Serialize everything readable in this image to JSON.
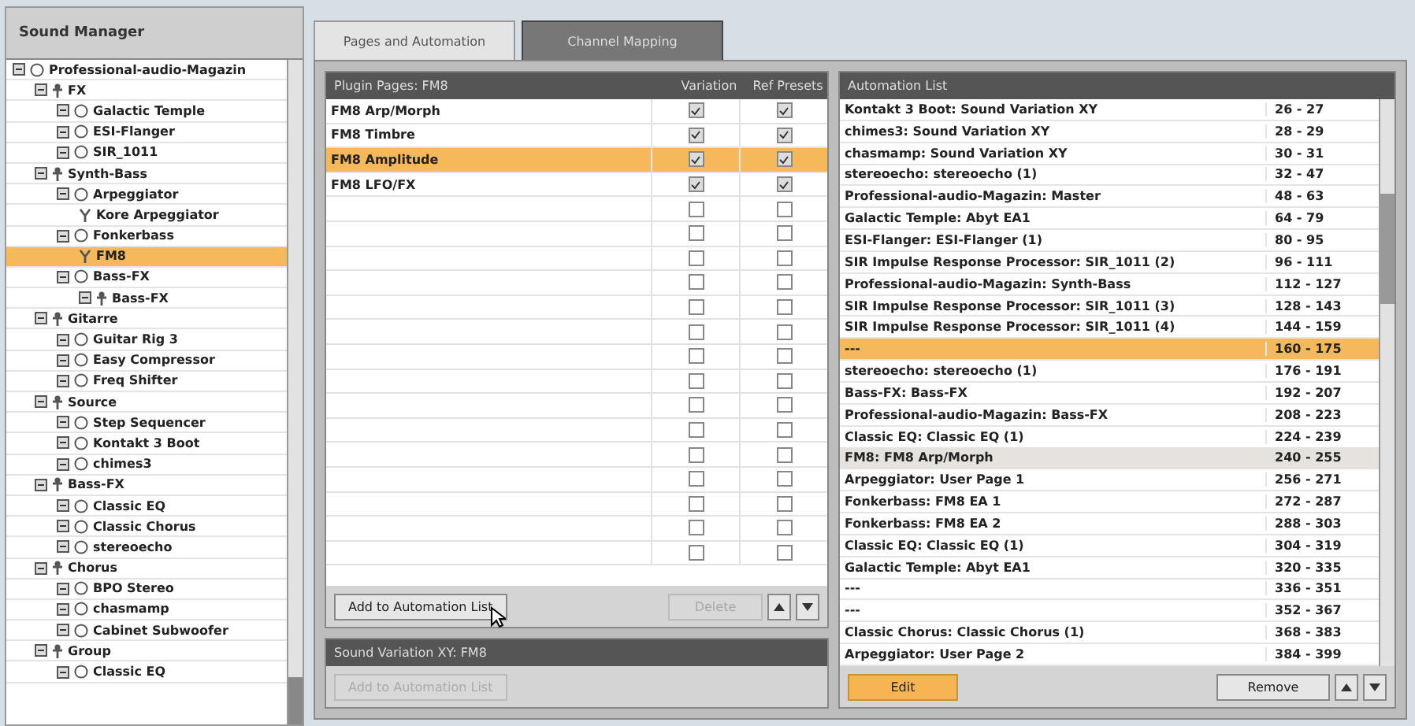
{
  "window": {
    "title": "Sound Manager"
  },
  "tree": [
    {
      "label": "Professional-audio-Magazin",
      "kind": "plugin",
      "selected": false,
      "children": [
        {
          "label": "FX",
          "kind": "group",
          "selected": false,
          "children": [
            {
              "label": "Galactic Temple",
              "kind": "plugin",
              "selected": false
            },
            {
              "label": "ESI-Flanger",
              "kind": "plugin",
              "selected": false
            },
            {
              "label": "SIR_1011",
              "kind": "plugin",
              "selected": false
            }
          ]
        },
        {
          "label": "Synth-Bass",
          "kind": "group",
          "selected": false,
          "children": [
            {
              "label": "Arpeggiator",
              "kind": "plugin",
              "selected": false,
              "children": [
                {
                  "label": "Kore Arpeggiator",
                  "kind": "page",
                  "selected": false
                }
              ]
            },
            {
              "label": "Fonkerbass",
              "kind": "plugin",
              "selected": false,
              "children": [
                {
                  "label": "FM8",
                  "kind": "page",
                  "selected": true
                }
              ]
            },
            {
              "label": "Bass-FX",
              "kind": "plugin",
              "selected": false,
              "children": [
                {
                  "label": "Bass-FX",
                  "kind": "group",
                  "selected": false
                }
              ]
            }
          ]
        },
        {
          "label": "Gitarre",
          "kind": "group",
          "selected": false,
          "children": [
            {
              "label": "Guitar Rig 3",
              "kind": "plugin",
              "selected": false
            },
            {
              "label": "Easy Compressor",
              "kind": "plugin",
              "selected": false
            },
            {
              "label": "Freq Shifter",
              "kind": "plugin",
              "selected": false
            }
          ]
        },
        {
          "label": "Source",
          "kind": "group",
          "selected": false,
          "children": [
            {
              "label": "Step Sequencer",
              "kind": "plugin",
              "selected": false
            },
            {
              "label": "Kontakt 3 Boot",
              "kind": "plugin",
              "selected": false
            },
            {
              "label": "chimes3",
              "kind": "plugin",
              "selected": false
            }
          ]
        },
        {
          "label": "Bass-FX",
          "kind": "group",
          "selected": false,
          "children": [
            {
              "label": "Classic EQ",
              "kind": "plugin",
              "selected": false
            },
            {
              "label": "Classic Chorus",
              "kind": "plugin",
              "selected": false
            },
            {
              "label": "stereoecho",
              "kind": "plugin",
              "selected": false
            }
          ]
        },
        {
          "label": "Chorus",
          "kind": "group",
          "selected": false,
          "children": [
            {
              "label": "BPO Stereo",
              "kind": "plugin",
              "selected": false
            },
            {
              "label": "chasmamp",
              "kind": "plugin",
              "selected": false
            },
            {
              "label": "Cabinet Subwoofer",
              "kind": "plugin",
              "selected": false
            }
          ]
        },
        {
          "label": "Group",
          "kind": "group",
          "selected": false,
          "children": [
            {
              "label": "Classic EQ",
              "kind": "plugin",
              "selected": false
            }
          ]
        }
      ]
    }
  ],
  "tabs": [
    {
      "label": "Pages and Automation",
      "selected": false
    },
    {
      "label": "Channel Mapping",
      "selected": true
    }
  ],
  "pages": {
    "title": "Plugin Pages: FM8",
    "columns": [
      "Variation",
      "Ref Presets"
    ],
    "rows": [
      {
        "name": "FM8 Arp/Morph",
        "variation": true,
        "presets": true,
        "selected": false
      },
      {
        "name": "FM8 Timbre",
        "variation": true,
        "presets": true,
        "selected": false
      },
      {
        "name": "FM8 Amplitude",
        "variation": true,
        "presets": true,
        "selected": true
      },
      {
        "name": "FM8 LFO/FX",
        "variation": true,
        "presets": true,
        "selected": false
      },
      {
        "variation": false,
        "presets": false,
        "selected": false
      },
      {
        "variation": false,
        "presets": false,
        "selected": false
      },
      {
        "variation": false,
        "presets": false,
        "selected": false
      },
      {
        "variation": false,
        "presets": false,
        "selected": false
      },
      {
        "variation": false,
        "presets": false,
        "selected": false
      },
      {
        "variation": false,
        "presets": false,
        "selected": false
      },
      {
        "variation": false,
        "presets": false,
        "selected": false
      },
      {
        "variation": false,
        "presets": false,
        "selected": false
      },
      {
        "variation": false,
        "presets": false,
        "selected": false
      },
      {
        "variation": false,
        "presets": false,
        "selected": false
      },
      {
        "variation": false,
        "presets": false,
        "selected": false
      },
      {
        "variation": false,
        "presets": false,
        "selected": false
      },
      {
        "variation": false,
        "presets": false,
        "selected": false
      },
      {
        "variation": false,
        "presets": false,
        "selected": false
      },
      {
        "variation": false,
        "presets": false,
        "selected": false
      }
    ],
    "buttons": [
      {
        "label": "Add to Automation List",
        "disabled": false
      },
      {
        "label": "Delete",
        "disabled": true
      }
    ]
  },
  "variation": {
    "title": "Sound Variation XY: FM8",
    "button": {
      "label": "Add to Automation List",
      "disabled": true
    }
  },
  "automation": {
    "title": "Automation List",
    "rows": [
      {
        "name": "Kontakt 3 Boot: Sound Variation XY",
        "range": "26 - 27",
        "selected": false,
        "hovered": false
      },
      {
        "name": "chimes3: Sound Variation XY",
        "range": "28 - 29",
        "selected": false,
        "hovered": false
      },
      {
        "name": "chasmamp: Sound Variation XY",
        "range": "30 - 31",
        "selected": false,
        "hovered": false
      },
      {
        "name": "stereoecho: stereoecho (1)",
        "range": "32 - 47",
        "selected": false,
        "hovered": false
      },
      {
        "name": "Professional-audio-Magazin: Master",
        "range": "48 - 63",
        "selected": false,
        "hovered": false
      },
      {
        "name": "Galactic Temple: Abyt EA1",
        "range": "64 - 79",
        "selected": false,
        "hovered": false
      },
      {
        "name": "ESI-Flanger: ESI-Flanger (1)",
        "range": "80 - 95",
        "selected": false,
        "hovered": false
      },
      {
        "name": "SIR Impulse Response Processor: SIR_1011 (2)",
        "range": "96 - 111",
        "selected": false,
        "hovered": false
      },
      {
        "name": "Professional-audio-Magazin: Synth-Bass",
        "range": "112 - 127",
        "selected": false,
        "hovered": false
      },
      {
        "name": "SIR Impulse Response Processor: SIR_1011 (3)",
        "range": "128 - 143",
        "selected": false,
        "hovered": false
      },
      {
        "name": "SIR Impulse Response Processor: SIR_1011 (4)",
        "range": "144 - 159",
        "selected": false,
        "hovered": false
      },
      {
        "name": "---",
        "range": "160 - 175",
        "selected": true,
        "hovered": false
      },
      {
        "name": "stereoecho: stereoecho (1)",
        "range": "176 - 191",
        "selected": false,
        "hovered": false
      },
      {
        "name": "Bass-FX: Bass-FX",
        "range": "192 - 207",
        "selected": false,
        "hovered": false
      },
      {
        "name": "Professional-audio-Magazin: Bass-FX",
        "range": "208 - 223",
        "selected": false,
        "hovered": false
      },
      {
        "name": "Classic EQ: Classic EQ (1)",
        "range": "224 - 239",
        "selected": false,
        "hovered": false
      },
      {
        "name": "FM8: FM8 Arp/Morph",
        "range": "240 - 255",
        "selected": false,
        "hovered": true
      },
      {
        "name": "Arpeggiator: User Page 1",
        "range": "256 - 271",
        "selected": false,
        "hovered": false
      },
      {
        "name": "Fonkerbass: FM8 EA 1",
        "range": "272 - 287",
        "selected": false,
        "hovered": false
      },
      {
        "name": "Fonkerbass: FM8 EA 2",
        "range": "288 - 303",
        "selected": false,
        "hovered": false
      },
      {
        "name": "Classic EQ: Classic EQ (1)",
        "range": "304 - 319",
        "selected": false,
        "hovered": false
      },
      {
        "name": "Galactic Temple: Abyt EA1",
        "range": "320 - 335",
        "selected": false,
        "hovered": false
      },
      {
        "name": "---",
        "range": "336 - 351",
        "selected": false,
        "hovered": false
      },
      {
        "name": "---",
        "range": "352 - 367",
        "selected": false,
        "hovered": false
      },
      {
        "name": "Classic Chorus: Classic Chorus (1)",
        "range": "368 - 383",
        "selected": false,
        "hovered": false
      },
      {
        "name": "Arpeggiator: User Page 2",
        "range": "384 - 399",
        "selected": false,
        "hovered": false
      }
    ],
    "buttons": [
      {
        "label": "Edit",
        "kind": "primary"
      },
      {
        "label": "Remove",
        "kind": "plain"
      }
    ]
  }
}
